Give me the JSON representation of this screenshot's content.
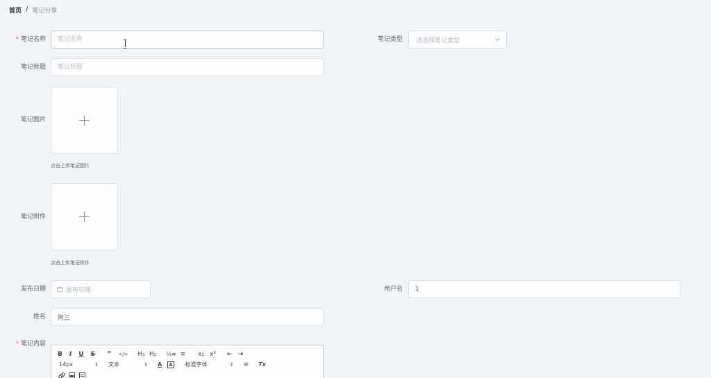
{
  "breadcrumb": {
    "home": "首页",
    "separator": "/",
    "current": "笔记分享"
  },
  "form": {
    "note_name": {
      "label": "笔记名称",
      "required": "*",
      "placeholder": "笔记名称",
      "value": ""
    },
    "note_type": {
      "label": "笔记类型",
      "placeholder": "请选择笔记类型"
    },
    "note_title": {
      "label": "笔记标题",
      "placeholder": "笔记标题",
      "value": ""
    },
    "note_image": {
      "label": "笔记图片",
      "hint": "点击上传笔记图片"
    },
    "note_attachment": {
      "label": "笔记附件",
      "hint": "点击上传笔记附件"
    },
    "publish_date": {
      "label": "发布日期",
      "placeholder": "发布日期"
    },
    "username": {
      "label": "用户名",
      "value": "1"
    },
    "full_name": {
      "label": "姓名",
      "value": "阿三"
    },
    "note_content": {
      "label": "笔记内容",
      "required": "*"
    }
  },
  "editor_toolbar": {
    "bold": "B",
    "italic": "I",
    "underline": "U",
    "strike": "S",
    "quote": "❞",
    "code": "</>",
    "h1": "H₁",
    "h2": "H₂",
    "ordered_list": "⅓≡",
    "bullet_list": "≡",
    "subscript": "x₂",
    "superscript": "x²",
    "indent_decrease": "⇤",
    "indent_increase": "⇥",
    "size": "14px",
    "header": "文本",
    "font": "标准字体",
    "font_color": "A",
    "bg_color": "A",
    "align": "≡",
    "clean": "Tx"
  },
  "colors": {
    "required": "#f56c6c",
    "border": "#dcdfe6",
    "placeholder": "#b8bcc4"
  }
}
